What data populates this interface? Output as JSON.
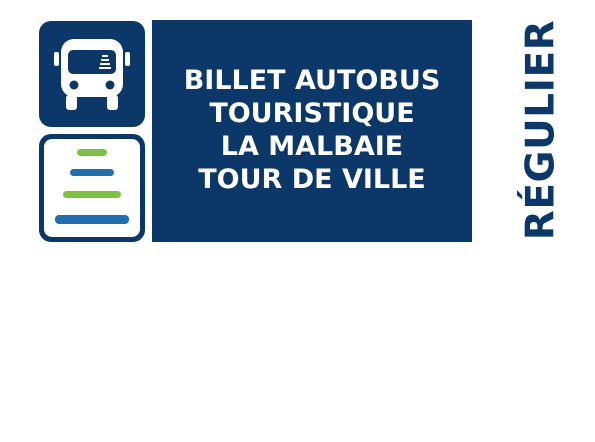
{
  "title": {
    "lines": [
      "BILLET AUTOBUS",
      "TOURISTIQUE",
      "LA MALBAIE",
      "TOUR DE VILLE"
    ]
  },
  "fare_type": "RÉGULIER",
  "icons": {
    "bus": "bus-icon",
    "route_lines": "route-lines-icon"
  },
  "colors": {
    "navy": "#0b3868",
    "blue": "#1e6fb2",
    "green": "#7dc142",
    "white": "#ffffff"
  }
}
